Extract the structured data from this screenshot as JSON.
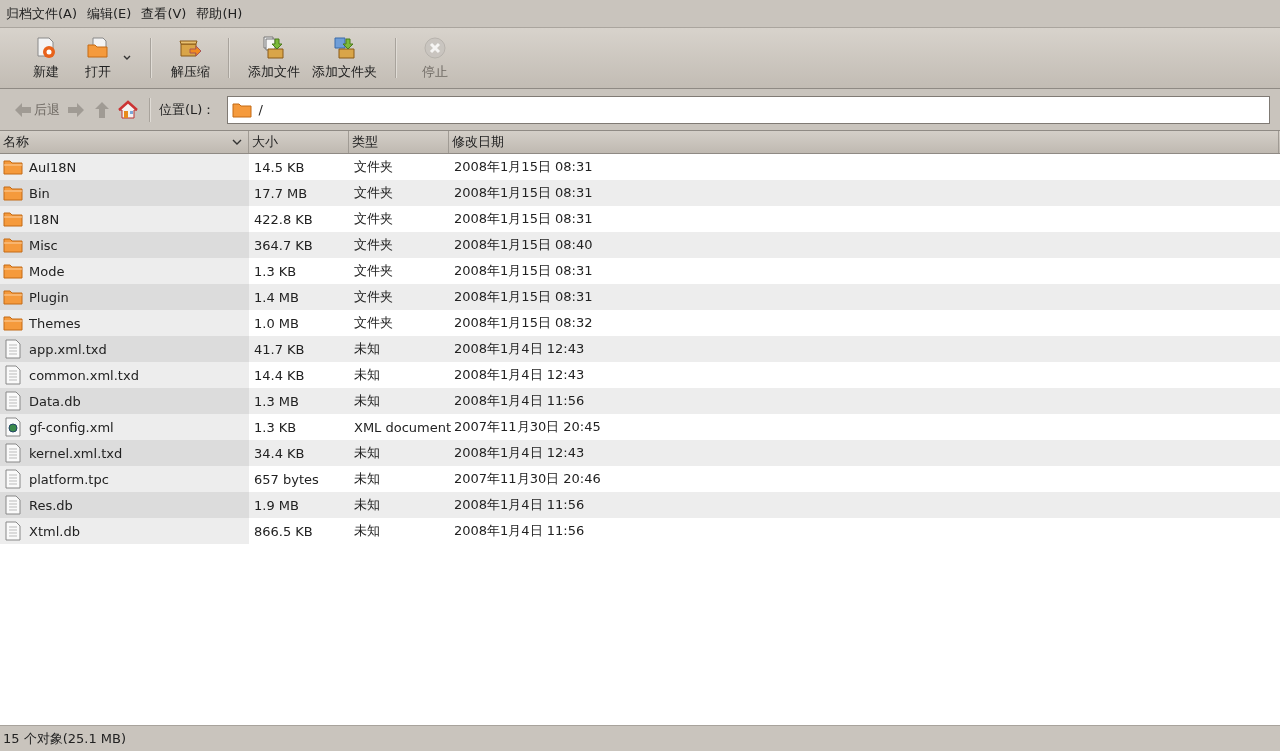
{
  "menu": [
    "归档文件(A)",
    "编辑(E)",
    "查看(V)",
    "帮助(H)"
  ],
  "toolbar": [
    {
      "kind": "new",
      "label": "新建",
      "disabled": false
    },
    {
      "kind": "open",
      "label": "打开",
      "disabled": false
    },
    {
      "kind": "extract",
      "label": "解压缩",
      "disabled": false
    },
    {
      "kind": "add-file",
      "label": "添加文件",
      "disabled": false
    },
    {
      "kind": "add-folder",
      "label": "添加文件夹",
      "disabled": false
    },
    {
      "kind": "stop",
      "label": "停止",
      "disabled": true
    }
  ],
  "navigation": {
    "buttons": [
      {
        "kind": "back",
        "label": "后退",
        "disabled": true
      },
      {
        "kind": "forward",
        "disabled": true
      },
      {
        "kind": "up",
        "disabled": true
      },
      {
        "kind": "home",
        "disabled": false
      }
    ],
    "location_label": "位置(L)：",
    "location": "/"
  },
  "table": {
    "columns": [
      "名称",
      "大小",
      "类型",
      "修改日期"
    ],
    "rows": [
      {
        "kind": "folder",
        "name": "AuI18N",
        "size": "14.5 KB",
        "type": "文件夹",
        "date": "2008年1月15日 08:31"
      },
      {
        "kind": "folder",
        "name": "Bin",
        "size": "17.7 MB",
        "type": "文件夹",
        "date": "2008年1月15日 08:31"
      },
      {
        "kind": "folder",
        "name": "I18N",
        "size": "422.8 KB",
        "type": "文件夹",
        "date": "2008年1月15日 08:31"
      },
      {
        "kind": "folder",
        "name": "Misc",
        "size": "364.7 KB",
        "type": "文件夹",
        "date": "2008年1月15日 08:40"
      },
      {
        "kind": "folder",
        "name": "Mode",
        "size": "1.3 KB",
        "type": "文件夹",
        "date": "2008年1月15日 08:31"
      },
      {
        "kind": "folder",
        "name": "Plugin",
        "size": "1.4 MB",
        "type": "文件夹",
        "date": "2008年1月15日 08:31"
      },
      {
        "kind": "folder",
        "name": "Themes",
        "size": "1.0 MB",
        "type": "文件夹",
        "date": "2008年1月15日 08:32"
      },
      {
        "kind": "file",
        "name": "app.xml.txd",
        "size": "41.7 KB",
        "type": "未知",
        "date": "2008年1月4日 12:43"
      },
      {
        "kind": "file",
        "name": "common.xml.txd",
        "size": "14.4 KB",
        "type": "未知",
        "date": "2008年1月4日 12:43"
      },
      {
        "kind": "file",
        "name": "Data.db",
        "size": "1.3 MB",
        "type": "未知",
        "date": "2008年1月4日 11:56"
      },
      {
        "kind": "xml",
        "name": "gf-config.xml",
        "size": "1.3 KB",
        "type": "XML document",
        "date": "2007年11月30日 20:45"
      },
      {
        "kind": "file",
        "name": "kernel.xml.txd",
        "size": "34.4 KB",
        "type": "未知",
        "date": "2008年1月4日 12:43"
      },
      {
        "kind": "file",
        "name": "platform.tpc",
        "size": "657 bytes",
        "type": "未知",
        "date": "2007年11月30日 20:46"
      },
      {
        "kind": "file",
        "name": "Res.db",
        "size": "1.9 MB",
        "type": "未知",
        "date": "2008年1月4日 11:56"
      },
      {
        "kind": "file",
        "name": "Xtml.db",
        "size": "866.5 KB",
        "type": "未知",
        "date": "2008年1月4日 11:56"
      }
    ]
  },
  "status_bar": "15 个对象(25.1 MB)"
}
